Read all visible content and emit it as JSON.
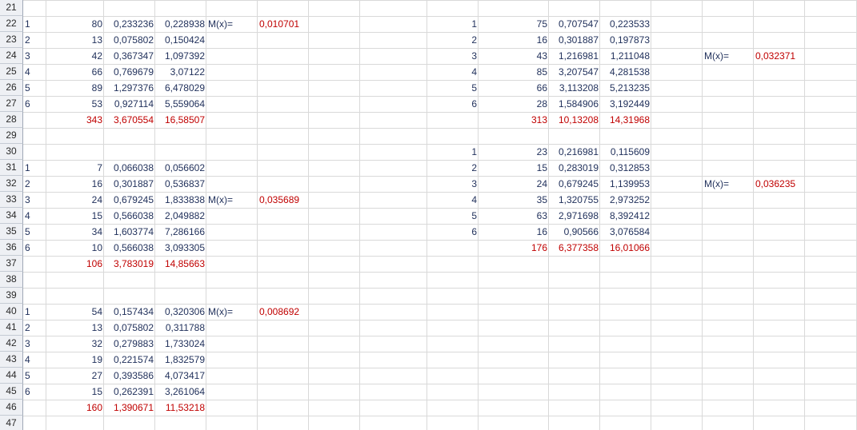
{
  "colors": {
    "value_text": "#1f2f5a",
    "total_text": "#c00000",
    "grid_line": "#d9d9d9",
    "header_bg": "#eef0f4"
  },
  "row_numbers": [
    "21",
    "22",
    "23",
    "24",
    "25",
    "26",
    "27",
    "28",
    "29",
    "30",
    "31",
    "32",
    "33",
    "34",
    "35",
    "36",
    "37",
    "38",
    "39",
    "40",
    "41",
    "42",
    "43",
    "44",
    "45",
    "46",
    "47"
  ],
  "blocks": [
    {
      "rows": [
        {
          "idx": "1",
          "x": "80",
          "p": "0,233236",
          "c": "0,228938"
        },
        {
          "idx": "2",
          "x": "13",
          "p": "0,075802",
          "c": "0,150424"
        },
        {
          "idx": "3",
          "x": "42",
          "p": "0,367347",
          "c": "1,097392"
        },
        {
          "idx": "4",
          "x": "66",
          "p": "0,769679",
          "c": "3,07122"
        },
        {
          "idx": "5",
          "x": "89",
          "p": "1,297376",
          "c": "6,478029"
        },
        {
          "idx": "6",
          "x": "53",
          "p": "0,927114",
          "c": "5,559064"
        }
      ],
      "total": {
        "x": "343",
        "p": "3,670554",
        "c": "16,58507"
      },
      "mx_label": "M(x)=",
      "mx_value": "0,010701"
    },
    {
      "rows": [
        {
          "idx": "1",
          "x": "7",
          "p": "0,066038",
          "c": "0,056602"
        },
        {
          "idx": "2",
          "x": "16",
          "p": "0,301887",
          "c": "0,536837"
        },
        {
          "idx": "3",
          "x": "24",
          "p": "0,679245",
          "c": "1,833838"
        },
        {
          "idx": "4",
          "x": "15",
          "p": "0,566038",
          "c": "2,049882"
        },
        {
          "idx": "5",
          "x": "34",
          "p": "1,603774",
          "c": "7,286166"
        },
        {
          "idx": "6",
          "x": "10",
          "p": "0,566038",
          "c": "3,093305"
        }
      ],
      "total": {
        "x": "106",
        "p": "3,783019",
        "c": "14,85663"
      },
      "mx_label": "M(x)=",
      "mx_value": "0,035689"
    },
    {
      "rows": [
        {
          "idx": "1",
          "x": "54",
          "p": "0,157434",
          "c": "0,320306"
        },
        {
          "idx": "2",
          "x": "13",
          "p": "0,075802",
          "c": "0,311788"
        },
        {
          "idx": "3",
          "x": "32",
          "p": "0,279883",
          "c": "1,733024"
        },
        {
          "idx": "4",
          "x": "19",
          "p": "0,221574",
          "c": "1,832579"
        },
        {
          "idx": "5",
          "x": "27",
          "p": "0,393586",
          "c": "4,073417"
        },
        {
          "idx": "6",
          "x": "15",
          "p": "0,262391",
          "c": "3,261064"
        }
      ],
      "total": {
        "x": "160",
        "p": "1,390671",
        "c": "11,53218"
      },
      "mx_label": "M(x)=",
      "mx_value": "0,008692"
    },
    {
      "rows": [
        {
          "idx": "1",
          "x": "75",
          "p": "0,707547",
          "c": "0,223533"
        },
        {
          "idx": "2",
          "x": "16",
          "p": "0,301887",
          "c": "0,197873"
        },
        {
          "idx": "3",
          "x": "43",
          "p": "1,216981",
          "c": "1,211048"
        },
        {
          "idx": "4",
          "x": "85",
          "p": "3,207547",
          "c": "4,281538"
        },
        {
          "idx": "5",
          "x": "66",
          "p": "3,113208",
          "c": "5,213235"
        },
        {
          "idx": "6",
          "x": "28",
          "p": "1,584906",
          "c": "3,192449"
        }
      ],
      "total": {
        "x": "313",
        "p": "10,13208",
        "c": "14,31968"
      },
      "mx_label": "M(x)=",
      "mx_value": "0,032371"
    },
    {
      "rows": [
        {
          "idx": "1",
          "x": "23",
          "p": "0,216981",
          "c": "0,115609"
        },
        {
          "idx": "2",
          "x": "15",
          "p": "0,283019",
          "c": "0,312853"
        },
        {
          "idx": "3",
          "x": "24",
          "p": "0,679245",
          "c": "1,139953"
        },
        {
          "idx": "4",
          "x": "35",
          "p": "1,320755",
          "c": "2,973252"
        },
        {
          "idx": "5",
          "x": "63",
          "p": "2,971698",
          "c": "8,392412"
        },
        {
          "idx": "6",
          "x": "16",
          "p": "0,90566",
          "c": "3,076584"
        }
      ],
      "total": {
        "x": "176",
        "p": "6,377358",
        "c": "16,01066"
      },
      "mx_label": "M(x)=",
      "mx_value": "0,036235"
    }
  ]
}
